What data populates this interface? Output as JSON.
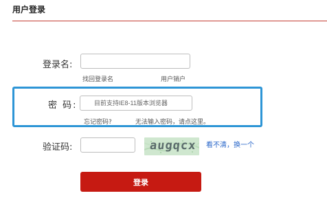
{
  "header": {
    "title": "用户登录"
  },
  "form": {
    "username": {
      "label": "登录名:",
      "value": "",
      "placeholder": "",
      "links": {
        "find_username": "找回登录名",
        "deregister_user": "用户销户"
      }
    },
    "password": {
      "label": "密 码:",
      "placeholder": "目前支持IE8-11版本浏览器",
      "value": "",
      "links": {
        "forgot": "忘记密码?",
        "cannot_input": "无法输入密码，请点这里。"
      }
    },
    "captcha": {
      "label": "验证码:",
      "value": "",
      "image_text": "augqcx",
      "refresh_link": "看不清，换一个"
    },
    "submit_label": "登录"
  },
  "colors": {
    "brand_red": "#c61a12",
    "title_rule": "#c23a2f",
    "highlight_blue": "#2d95d6",
    "captcha_bg": "#cfe7cf",
    "link_blue": "#2a67c9"
  }
}
